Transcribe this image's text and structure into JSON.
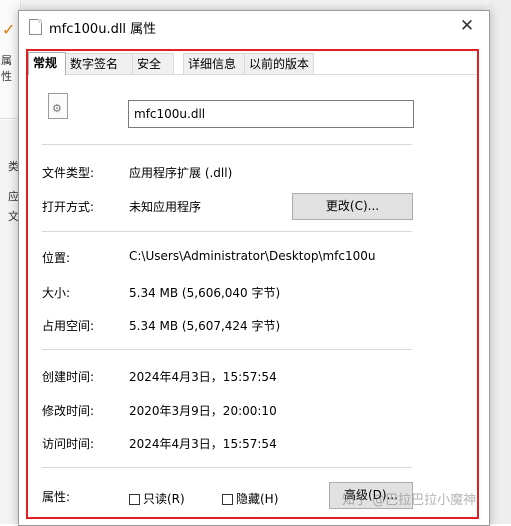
{
  "background": {
    "sidebar_labels": [
      "属性",
      "类",
      "应",
      "文"
    ]
  },
  "dialog": {
    "title": "mfc100u.dll 属性",
    "close_glyph": "✕",
    "tabs": [
      "常规",
      "数字签名",
      "安全",
      "详细信息",
      "以前的版本"
    ],
    "active_tab": "常规",
    "file_name": "mfc100u.dll",
    "fields": {
      "type_label": "文件类型:",
      "type_value": "应用程序扩展 (.dll)",
      "open_with_label": "打开方式:",
      "open_with_value": "未知应用程序",
      "change_button": "更改(C)...",
      "location_label": "位置:",
      "location_value": "C:\\Users\\Administrator\\Desktop\\mfc100u",
      "size_label": "大小:",
      "size_value": "5.34 MB (5,606,040 字节)",
      "disk_size_label": "占用空间:",
      "disk_size_value": "5.34 MB (5,607,424 字节)",
      "created_label": "创建时间:",
      "created_value": "2024年4月3日，15:57:54",
      "modified_label": "修改时间:",
      "modified_value": "2020年3月9日，20:00:10",
      "accessed_label": "访问时间:",
      "accessed_value": "2024年4月3日，15:57:54",
      "attributes_label": "属性:",
      "readonly_label": "只读(R)",
      "hidden_label": "隐藏(H)",
      "advanced_button": "高级(D)..."
    },
    "highlight_color": "#e02020"
  },
  "watermark": "知乎 @巴拉巴拉小魔神"
}
